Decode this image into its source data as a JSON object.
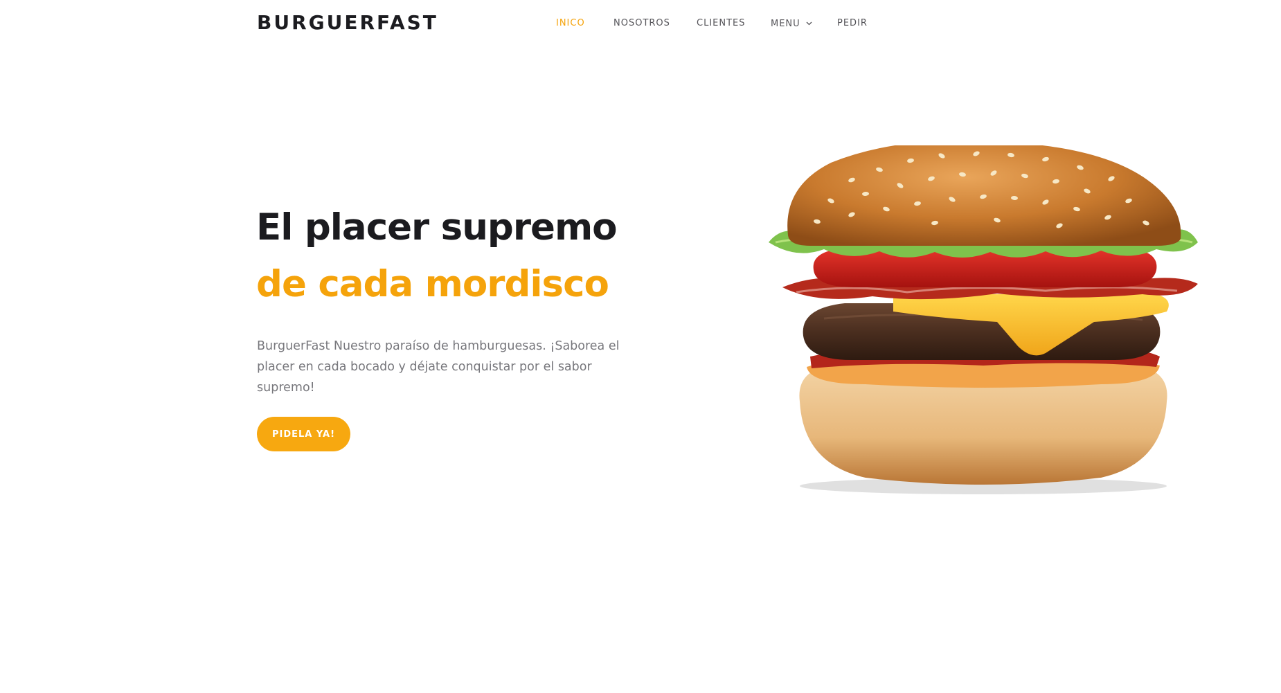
{
  "header": {
    "brand": "BURGUERFAST",
    "nav": [
      {
        "label": "INICO",
        "active": true
      },
      {
        "label": "NOSOTROS",
        "active": false
      },
      {
        "label": "CLIENTES",
        "active": false
      },
      {
        "label": "MENU",
        "active": false,
        "has_dropdown": true
      },
      {
        "label": "PEDIR",
        "active": false
      }
    ],
    "dropdown_icon": "chevron-down-icon"
  },
  "hero": {
    "title_line1": "El placer supremo",
    "title_line2": "de cada mordisco",
    "description": "BurguerFast Nuestro paraíso de hamburguesas. ¡Saborea el placer en cada bocado y déjate conquistar por el sabor supremo!",
    "cta_label": "PIDELA YA!",
    "image": "hamburger-image"
  },
  "colors": {
    "accent": "#f5a30b",
    "text_dark": "#1c1c20",
    "text_muted": "#77777c",
    "nav_text": "#555459",
    "background": "#ffffff"
  }
}
